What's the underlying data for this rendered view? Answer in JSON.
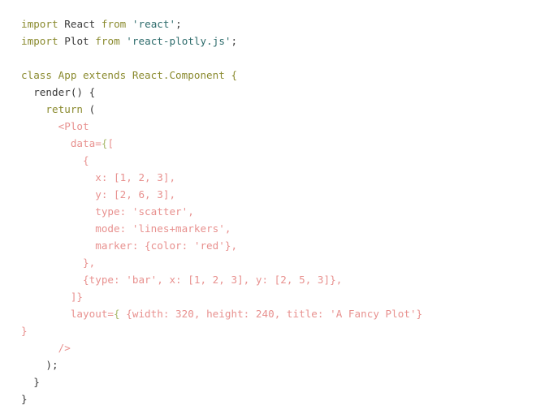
{
  "editor": {
    "background": "#ffffff",
    "colors": {
      "keyword": "#8a8a2e",
      "identifier": "#3a3a3a",
      "string": "#2d6b6b",
      "jsx": "#e8918f",
      "brace": "#a8b96a"
    },
    "language": "jsx",
    "lines": [
      {
        "n": 1,
        "tokens": [
          {
            "t": "import",
            "c": "kw"
          },
          {
            "t": " ",
            "c": "id"
          },
          {
            "t": "React",
            "c": "id"
          },
          {
            "t": " ",
            "c": "id"
          },
          {
            "t": "from",
            "c": "kw"
          },
          {
            "t": " ",
            "c": "id"
          },
          {
            "t": "'react'",
            "c": "str"
          },
          {
            "t": ";",
            "c": "id"
          }
        ]
      },
      {
        "n": 2,
        "tokens": [
          {
            "t": "import",
            "c": "kw"
          },
          {
            "t": " ",
            "c": "id"
          },
          {
            "t": "Plot",
            "c": "id"
          },
          {
            "t": " ",
            "c": "id"
          },
          {
            "t": "from",
            "c": "kw"
          },
          {
            "t": " ",
            "c": "id"
          },
          {
            "t": "'react-plotly.js'",
            "c": "str"
          },
          {
            "t": ";",
            "c": "id"
          }
        ]
      },
      {
        "n": 3,
        "tokens": []
      },
      {
        "n": 4,
        "tokens": [
          {
            "t": "class App extends React.Component {",
            "c": "kw"
          }
        ]
      },
      {
        "n": 5,
        "tokens": [
          {
            "t": "  render() {",
            "c": "id"
          }
        ]
      },
      {
        "n": 6,
        "tokens": [
          {
            "t": "    ",
            "c": "id"
          },
          {
            "t": "return",
            "c": "kw"
          },
          {
            "t": " (",
            "c": "id"
          }
        ]
      },
      {
        "n": 7,
        "tokens": [
          {
            "t": "      <Plot",
            "c": "jsx"
          }
        ]
      },
      {
        "n": 8,
        "tokens": [
          {
            "t": "        data=",
            "c": "jsx"
          },
          {
            "t": "{",
            "c": "brc"
          },
          {
            "t": "[",
            "c": "jsx"
          }
        ]
      },
      {
        "n": 9,
        "tokens": [
          {
            "t": "          {",
            "c": "jsx"
          }
        ]
      },
      {
        "n": 10,
        "tokens": [
          {
            "t": "            x: [1, 2, 3],",
            "c": "jsx"
          }
        ]
      },
      {
        "n": 11,
        "tokens": [
          {
            "t": "            y: [2, 6, 3],",
            "c": "jsx"
          }
        ]
      },
      {
        "n": 12,
        "tokens": [
          {
            "t": "            type: 'scatter',",
            "c": "jsx"
          }
        ]
      },
      {
        "n": 13,
        "tokens": [
          {
            "t": "            mode: 'lines+markers',",
            "c": "jsx"
          }
        ]
      },
      {
        "n": 14,
        "tokens": [
          {
            "t": "            marker: {color: 'red'},",
            "c": "jsx"
          }
        ]
      },
      {
        "n": 15,
        "tokens": [
          {
            "t": "          },",
            "c": "jsx"
          }
        ]
      },
      {
        "n": 16,
        "tokens": [
          {
            "t": "          {type: 'bar', x: [1, 2, 3], y: [2, 5, 3]},",
            "c": "jsx"
          }
        ]
      },
      {
        "n": 17,
        "tokens": [
          {
            "t": "        ]}",
            "c": "jsx"
          }
        ]
      },
      {
        "n": 18,
        "tokens": [
          {
            "t": "        layout=",
            "c": "jsx"
          },
          {
            "t": "{",
            "c": "brc"
          },
          {
            "t": " {width: 320, height: 240, title: 'A Fancy Plot'}",
            "c": "jsx"
          }
        ]
      },
      {
        "n": 19,
        "tokens": [
          {
            "t": "}",
            "c": "jsx"
          }
        ]
      },
      {
        "n": 20,
        "tokens": [
          {
            "t": "      />",
            "c": "jsx"
          }
        ]
      },
      {
        "n": 21,
        "tokens": [
          {
            "t": "    );",
            "c": "id"
          }
        ]
      },
      {
        "n": 22,
        "tokens": [
          {
            "t": "  }",
            "c": "id"
          }
        ]
      },
      {
        "n": 23,
        "tokens": [
          {
            "t": "}",
            "c": "id"
          }
        ]
      }
    ]
  }
}
